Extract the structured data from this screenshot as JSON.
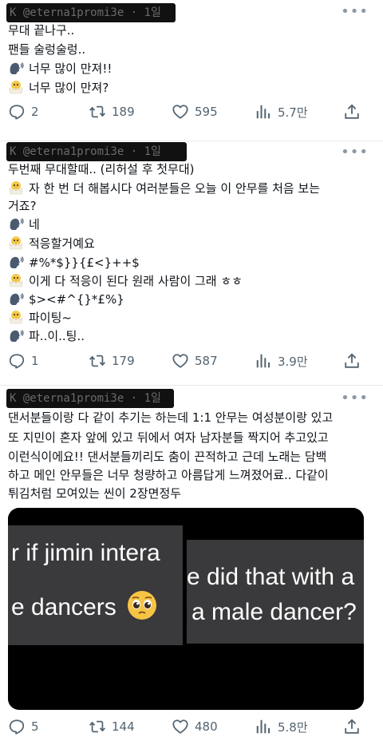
{
  "tweets": [
    {
      "handle": "K @eterna1promi3e · 1일",
      "lines": [
        "무대 끝나구..",
        "팬들 술렁술렁..",
        "너무 많이 만져!!",
        "너무 많이 만져?"
      ],
      "stats": {
        "replies": "2",
        "retweets": "189",
        "likes": "595",
        "views": "5.7만"
      }
    },
    {
      "handle": "K @eterna1promi3e · 1일",
      "lines": [
        "두번째 무대할때.. (리허설 후 첫무대)",
        "자 한 번 더 해봅시다 여러분들은 오늘 이 안무를 처음 보는",
        "거죠?",
        "네",
        "적응할거예요",
        "#%*$}}{£<}++$",
        "이게 다 적응이 된다 원래 사람이 그래 ㅎㅎ",
        "$><#^{}*£%}",
        "파이팅~",
        "파..이..팅.."
      ],
      "stats": {
        "replies": "1",
        "retweets": "179",
        "likes": "587",
        "views": "3.9만"
      }
    },
    {
      "handle": "K @eterna1promi3e · 1일",
      "lines": [
        "댄서분들이랑 다 같이 추기는 하는데 1:1 안무는 여성분이랑 있고",
        "또 지민이 혼자 앞에 있고 뒤에서 여자 남자분들 짝지어 추고있고",
        "이런식이에요!! 댄서분들끼리도 춤이 끈적하고 근데 노래는 담백",
        "하고 메인 안무들은 너무 청량하고 아름답게 느껴졌어료.. 다같이",
        "튀김처럼 모여있는 씬이 2장면정두"
      ],
      "media": {
        "left_line1": "r if jimin intera",
        "left_line2": "e dancers",
        "right_line1": "e did that with a",
        "right_line2": "a male dancer?"
      },
      "stats": {
        "replies": "5",
        "retweets": "144",
        "likes": "480",
        "views": "5.8만"
      }
    }
  ],
  "icons": {
    "chick": "hatching-chick-emoji",
    "speaker": "speaking-head-emoji",
    "pleading": "pleading-face-emoji",
    "reply": "reply-icon",
    "retweet": "retweet-icon",
    "like": "heart-icon",
    "views": "views-icon",
    "share": "share-icon",
    "more": "more-icon"
  },
  "colors": {
    "icon_gray": "#536471",
    "text": "#0f1419",
    "blackout": "#111111"
  }
}
